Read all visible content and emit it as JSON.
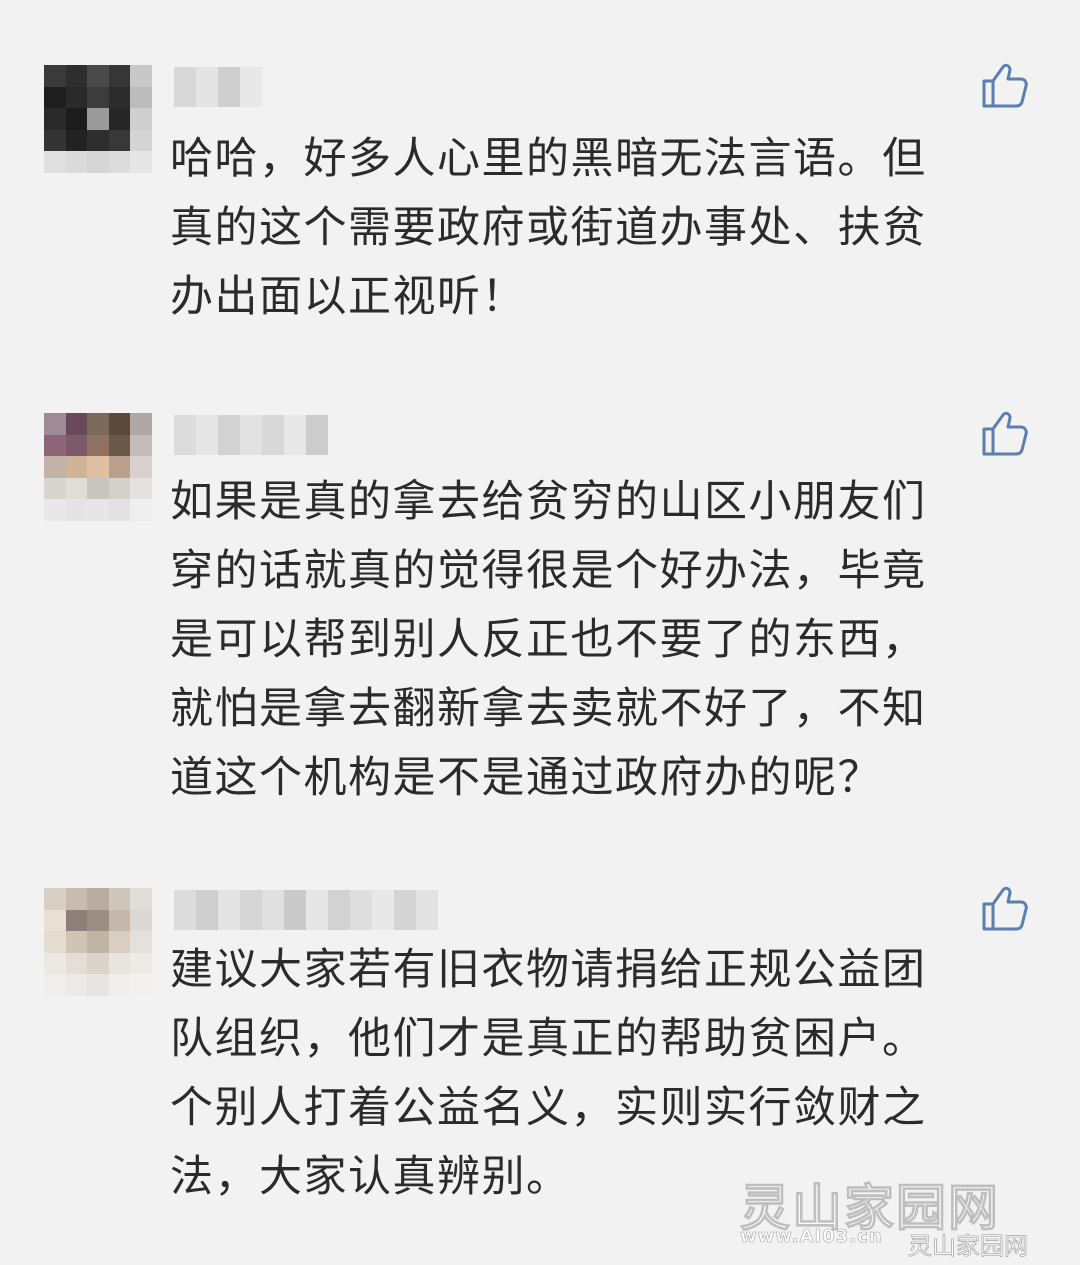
{
  "comments": [
    {
      "text_lines": [
        "哈哈，好多人心里的黑暗无法言语。但",
        "真的这个需要政府或街道办事处、扶贫",
        "办出面以正视听！"
      ],
      "avatar_colors": [
        "#3a3a3a",
        "#2e2e2e",
        "#4a4a4a",
        "#363636",
        "#c8c8c8",
        "#1e1e1e",
        "#2a2a2a",
        "#3c3c3c",
        "#2c2c2c",
        "#bcbcbc",
        "#2a2a2a",
        "#1c1c1c",
        "#9a9a9a",
        "#262626",
        "#cfcfcf",
        "#343434",
        "#222222",
        "#2e2e2e",
        "#383838",
        "#d4d4d4",
        "#e0e0e0",
        "#dadada",
        "#d6d6d6",
        "#dcdcdc",
        "#e6e6e6"
      ],
      "name_colors": [
        "#d8d8d8",
        "#e4e4e4",
        "#cfcfcf",
        "#e8e8e8"
      ]
    },
    {
      "text_lines": [
        "如果是真的拿去给贫穷的山区小朋友们",
        "穿的话就真的觉得很是个好办法，毕竟",
        "是可以帮到别人反正也不要了的东西，",
        "就怕是拿去翻新拿去卖就不好了，不知",
        "道这个机构是不是通过政府办的呢？"
      ],
      "avatar_colors": [
        "#a08a94",
        "#6a4a5a",
        "#7a6a5a",
        "#5a4a3a",
        "#b0a8a4",
        "#8e6478",
        "#7c5a6a",
        "#907060",
        "#6a5a4a",
        "#c4bcb8",
        "#c2b2a8",
        "#d0b49a",
        "#e0c0a0",
        "#b8a08c",
        "#d8d0cc",
        "#d8d4d0",
        "#e0dcd8",
        "#c8c4c0",
        "#d4d0cc",
        "#e4e2e0",
        "#e8e8e8",
        "#e4e4e4",
        "#e6e6e6",
        "#e2e2e2",
        "#eeeeee"
      ],
      "name_colors": [
        "#dcdcdc",
        "#e6e6e6",
        "#d2d2d2",
        "#e2e2e2",
        "#d8d8d8",
        "#e8e8e8",
        "#cccccc"
      ]
    },
    {
      "text_lines": [
        "建议大家若有旧衣物请捐给正规公益团",
        "队组织，他们才是真正的帮助贫困户。",
        "个别人打着公益名义，实则实行敛财之",
        "法，大家认真辨别。"
      ],
      "avatar_colors": [
        "#d8d0c4",
        "#c8bcb0",
        "#b8aca0",
        "#cfc6bc",
        "#e0dcd8",
        "#e8e0d4",
        "#8c8078",
        "#9a8e84",
        "#c4b8ac",
        "#dcd8d4",
        "#e4dcd0",
        "#d0c4b4",
        "#c0b4a4",
        "#d8cec2",
        "#e4e0dc",
        "#ece8e4",
        "#e4ded6",
        "#dcd4ca",
        "#e8e4e0",
        "#eeeae6",
        "#f0eeec",
        "#eceae8",
        "#e8e6e4",
        "#f0efee",
        "#f2f1f0"
      ],
      "name_colors": [
        "#dcdcdc",
        "#cfcfcf",
        "#e4e4e4",
        "#d6d6d6",
        "#e0e0e0",
        "#cacaca",
        "#e6e6e6",
        "#d2d2d2",
        "#dedede",
        "#e8e8e8",
        "#d4d4d4",
        "#e2e2e2"
      ]
    }
  ],
  "watermark": {
    "main": "灵山家园网",
    "url": "www.AI03.cn",
    "small": "灵山家园网"
  },
  "colors": {
    "background": "#f2f2f2",
    "text": "#2b2b2b",
    "like_icon": "#5b7fae"
  },
  "icons": {
    "like": "thumbs-up-icon"
  }
}
